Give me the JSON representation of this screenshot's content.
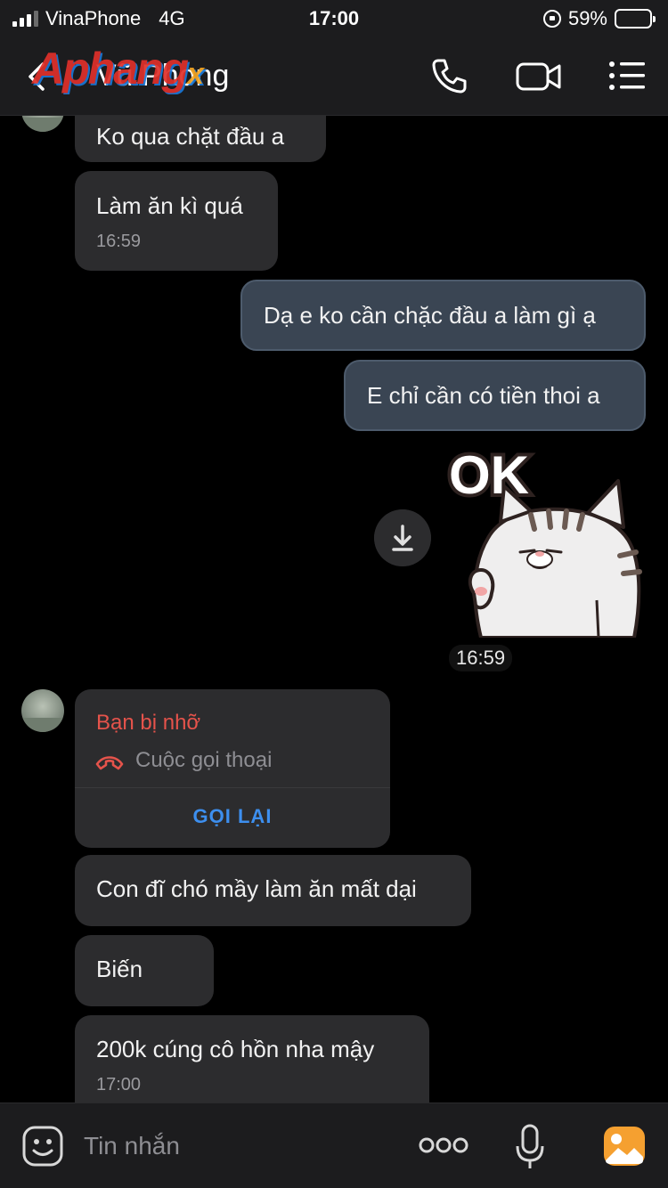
{
  "status_bar": {
    "carrier": "VinaPhone",
    "network": "4G",
    "time": "17:00",
    "battery_percent_text": "59%",
    "battery_level": 0.59
  },
  "header": {
    "back_icon": "chevron-left-icon",
    "contact_name": "Vũ Phong",
    "watermark": "Aphang",
    "watermark_x": "x",
    "call_icon": "phone-icon",
    "video_icon": "video-camera-icon",
    "menu_icon": "list-menu-icon"
  },
  "messages": [
    {
      "text": "Ko qua chặt đầu a",
      "dir": "in"
    },
    {
      "text": "Làm ăn kì quá",
      "time": "16:59",
      "dir": "in"
    },
    {
      "text": "Dạ e ko cần chặc đầu a làm gì ạ",
      "dir": "out"
    },
    {
      "text": "E chỉ cần có tiền thoi a",
      "dir": "out"
    },
    {
      "text": "Con đĩ chó mầy làm ăn mất dại",
      "dir": "in"
    },
    {
      "text": "Biến",
      "dir": "in"
    },
    {
      "text": "200k cúng cô hồn nha mậy",
      "time": "17:00",
      "dir": "in"
    }
  ],
  "sticker": {
    "text": "OK",
    "time": "16:59",
    "download_icon": "download-icon"
  },
  "missed_call": {
    "title": "Bạn bị nhỡ",
    "subtitle": "Cuộc gọi thoại",
    "action": "GỌI LẠI"
  },
  "composer": {
    "placeholder": "Tin nhắn",
    "emoji_icon": "sticker-face-icon",
    "more_icon": "more-dots-icon",
    "mic_icon": "microphone-icon",
    "image_icon": "image-gallery-icon"
  },
  "colors": {
    "background": "#000000",
    "incoming_bubble": "#2c2c2e",
    "outgoing_bubble": "#3a4553",
    "missed_red": "#e5534b",
    "link_blue": "#3d8fef",
    "image_icon_orange": "#f5a030"
  }
}
